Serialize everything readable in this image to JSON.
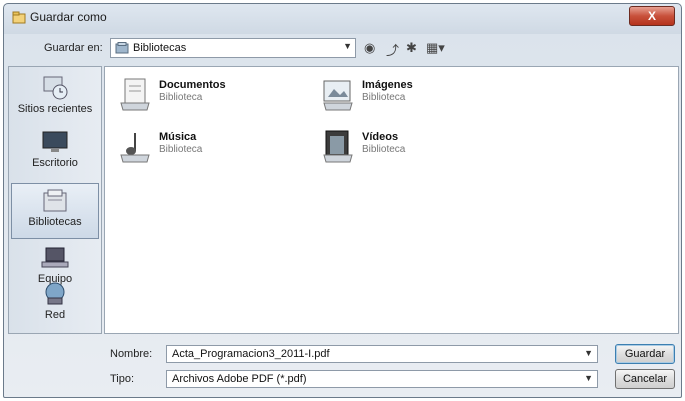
{
  "window": {
    "title": "Guardar como",
    "close_label": "X"
  },
  "toolbar": {
    "save_in_label": "Guardar en:",
    "location": "Bibliotecas",
    "icons": [
      "back-icon",
      "up-folder-icon",
      "new-folder-icon",
      "views-menu-icon"
    ]
  },
  "places": [
    {
      "label": "Sitios recientes"
    },
    {
      "label": "Escritorio"
    },
    {
      "label": "Bibliotecas",
      "selected": true
    },
    {
      "label": "Equipo"
    },
    {
      "label": "Red"
    }
  ],
  "items": [
    {
      "name": "Documentos",
      "type": "Biblioteca"
    },
    {
      "name": "Imágenes",
      "type": "Biblioteca"
    },
    {
      "name": "Música",
      "type": "Biblioteca"
    },
    {
      "name": "Vídeos",
      "type": "Biblioteca"
    }
  ],
  "form": {
    "name_label": "Nombre:",
    "name_value": "Acta_Programacion3_2011-I.pdf",
    "type_label": "Tipo:",
    "type_value": "Archivos Adobe PDF (*.pdf)"
  },
  "buttons": {
    "save": "Guardar",
    "cancel": "Cancelar"
  }
}
